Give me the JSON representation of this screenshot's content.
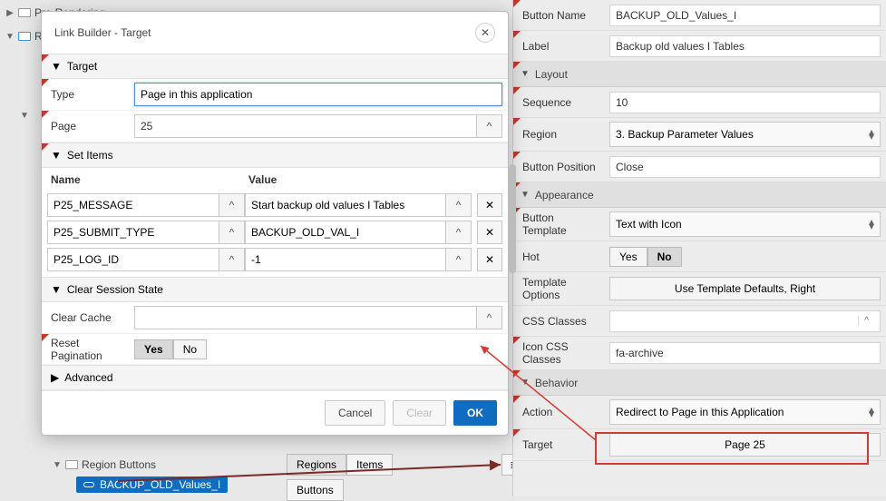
{
  "tree": {
    "pre_rendering": "Pre-Rendering",
    "r_prefix": "R",
    "region_buttons": "Region Buttons",
    "active_item": "BACKUP_OLD_Values_I"
  },
  "toolbar": {
    "regions": "Regions",
    "items": "Items",
    "buttons": "Buttons",
    "menu_glyph": "≣ ▾"
  },
  "modal": {
    "title": "Link Builder - Target",
    "sections": {
      "target": "Target",
      "set_items": "Set Items",
      "clear_session": "Clear Session State",
      "advanced": "Advanced"
    },
    "labels": {
      "type": "Type",
      "page": "Page",
      "name_col": "Name",
      "value_col": "Value",
      "clear_cache": "Clear Cache",
      "reset_pagination": "Reset Pagination"
    },
    "fields": {
      "type": "Page in this application",
      "page": "25",
      "clear_cache": ""
    },
    "set_items": [
      {
        "name": "P25_MESSAGE",
        "value": "Start backup old values I Tables"
      },
      {
        "name": "P25_SUBMIT_TYPE",
        "value": "BACKUP_OLD_VAL_I"
      },
      {
        "name": "P25_LOG_ID",
        "value": "-1"
      }
    ],
    "reset_pagination": {
      "yes": "Yes",
      "no": "No",
      "selected": "Yes"
    },
    "buttons": {
      "cancel": "Cancel",
      "clear": "Clear",
      "ok": "OK"
    }
  },
  "panel": {
    "labels": {
      "button_name": "Button Name",
      "label": "Label",
      "layout": "Layout",
      "sequence": "Sequence",
      "region": "Region",
      "button_position": "Button Position",
      "appearance": "Appearance",
      "button_template": "Button Template",
      "hot": "Hot",
      "template_options": "Template Options",
      "css_classes": "CSS Classes",
      "icon_css": "Icon CSS Classes",
      "behavior": "Behavior",
      "action": "Action",
      "target": "Target"
    },
    "values": {
      "button_name": "BACKUP_OLD_Values_I",
      "label": "Backup old values I Tables",
      "sequence": "10",
      "region": "3. Backup Parameter Values",
      "button_position": "Close",
      "button_template": "Text with Icon",
      "hot_yes": "Yes",
      "hot_no": "No",
      "template_options_btn": "Use Template Defaults, Right",
      "css_classes": "",
      "icon_css": "fa-archive",
      "action": "Redirect to Page in this Application",
      "target": "Page 25"
    }
  }
}
